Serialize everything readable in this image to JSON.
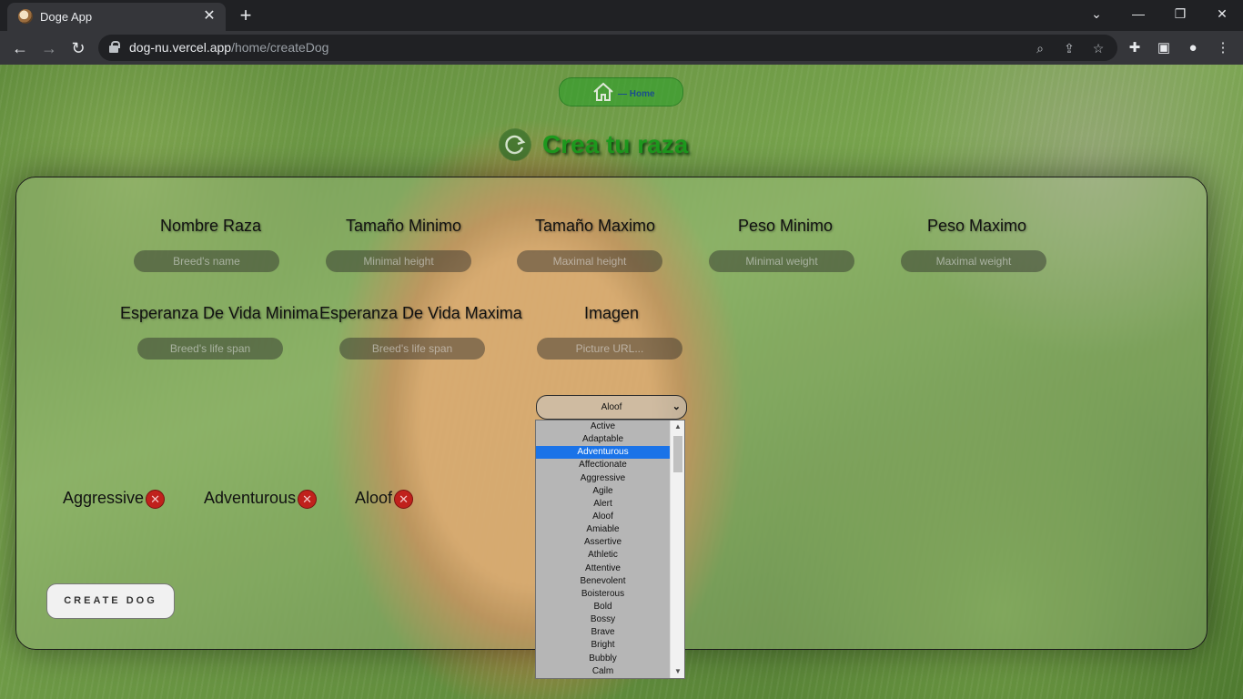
{
  "browser": {
    "tab_title": "Doge App",
    "tab_close": "✕",
    "new_tab": "+",
    "url_host": "dog-nu.vercel.app",
    "url_path": "/home/createDog",
    "window_controls": [
      "⌄",
      "—",
      "❐",
      "✕"
    ]
  },
  "header": {
    "home_label": "— Home",
    "title": "Crea tu raza"
  },
  "form": {
    "fields": [
      {
        "label": "Nombre Raza",
        "placeholder": "Breed's name"
      },
      {
        "label": "Tamaño Minimo",
        "placeholder": "Minimal height"
      },
      {
        "label": "Tamaño Maximo",
        "placeholder": "Maximal height"
      },
      {
        "label": "Peso Minimo",
        "placeholder": "Minimal weight"
      },
      {
        "label": "Peso Maximo",
        "placeholder": "Maximal weight"
      },
      {
        "label": "Esperanza De Vida Minima",
        "placeholder": "Breed's life span"
      },
      {
        "label": "Esperanza De Vida Maxima",
        "placeholder": "Breed's life span"
      },
      {
        "label": "Imagen",
        "placeholder": "Picture URL..."
      }
    ],
    "temperament_select": {
      "selected": "Aloof"
    },
    "selected_temperaments": [
      "Aggressive",
      "Adventurous",
      "Aloof"
    ],
    "create_button": "CREATE DOG"
  },
  "dropdown": {
    "highlighted": "Adventurous",
    "options": [
      "Active",
      "Adaptable",
      "Adventurous",
      "Affectionate",
      "Aggressive",
      "Agile",
      "Alert",
      "Aloof",
      "Amiable",
      "Assertive",
      "Athletic",
      "Attentive",
      "Benevolent",
      "Boisterous",
      "Bold",
      "Bossy",
      "Brave",
      "Bright",
      "Bubbly",
      "Calm"
    ]
  }
}
